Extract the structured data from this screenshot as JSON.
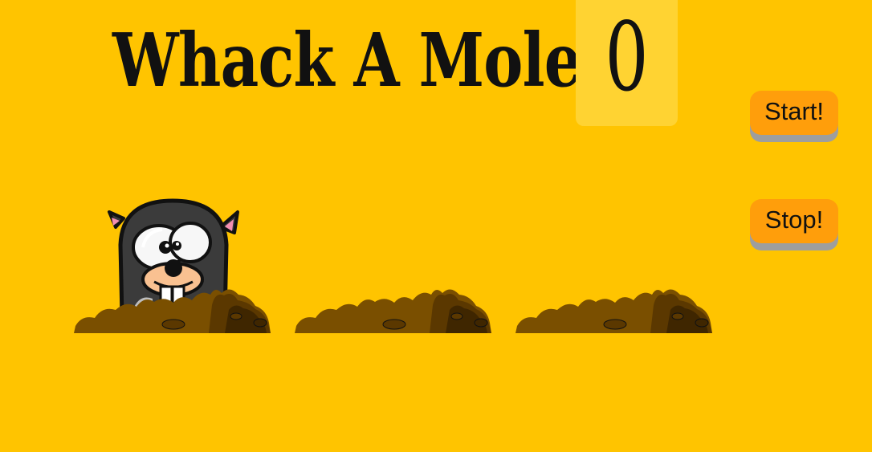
{
  "game": {
    "title": "Whack A Mole!",
    "score": "0"
  },
  "controls": {
    "start_label": "Start!",
    "stop_label": "Stop!"
  },
  "board": {
    "holes": [
      {
        "has_mole": true
      },
      {
        "has_mole": false
      },
      {
        "has_mole": false
      }
    ]
  },
  "colors": {
    "background": "#FFC400",
    "score_panel": "#FFD332",
    "button": "#FF9E0B",
    "button_shadow": "#9E9E9E",
    "dirt": "#7A4F00",
    "mole_body": "#3B3B3B"
  },
  "icons": {
    "mole": "mole-icon",
    "dirt": "dirt-mound-icon"
  }
}
